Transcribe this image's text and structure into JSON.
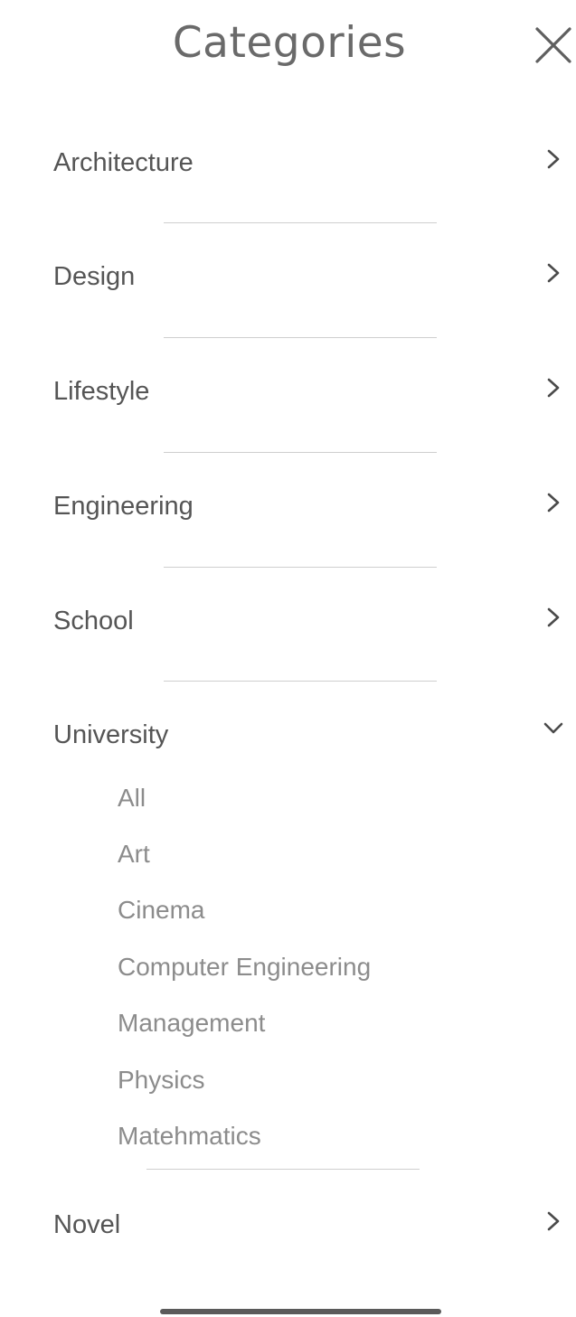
{
  "header": {
    "title": "Categories",
    "close_icon": "close-icon"
  },
  "categories": [
    {
      "label": "Architecture",
      "expanded": false
    },
    {
      "label": "Design",
      "expanded": false
    },
    {
      "label": "Lifestyle",
      "expanded": false
    },
    {
      "label": "Engineering",
      "expanded": false
    },
    {
      "label": "School",
      "expanded": false
    },
    {
      "label": "University",
      "expanded": true,
      "subitems": [
        "All",
        "Art",
        "Cinema",
        "Computer Engineering",
        "Management",
        "Physics",
        "Matehmatics"
      ]
    },
    {
      "label": "Novel",
      "expanded": false
    }
  ],
  "colors": {
    "text": "#555555",
    "subtext": "#8c8c8c",
    "divider": "#cfcfcf",
    "title": "#6a6a6a"
  }
}
